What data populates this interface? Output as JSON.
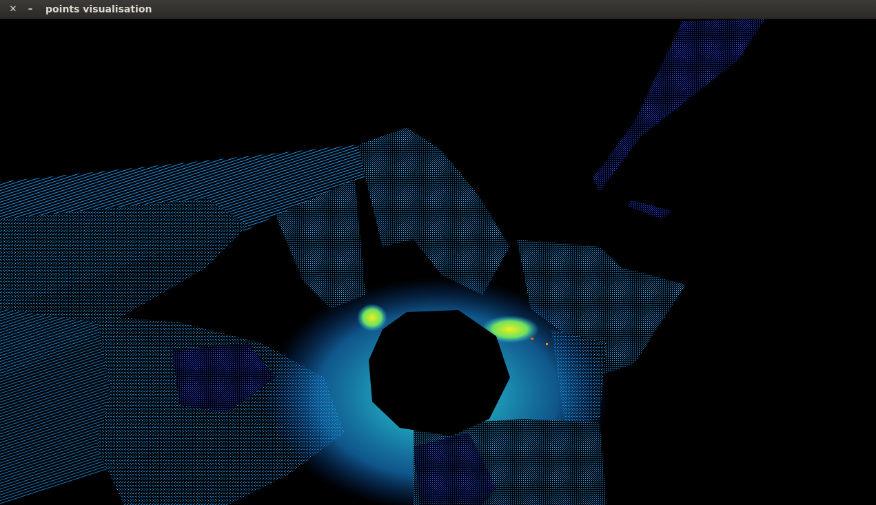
{
  "window": {
    "title": "points visualisation",
    "close_glyph": "✕",
    "minimize_glyph": "–"
  },
  "icons": {
    "close": "close-icon",
    "minimize": "minimize-icon"
  },
  "colors": {
    "titlebar": "#3c3b37",
    "title_text": "#dfdbd2",
    "background": "#000000",
    "point_low": "#0a1ad8",
    "point_mid": "#1aa6ff",
    "point_high": "#c8f020",
    "point_peak": "#ff6a00"
  }
}
